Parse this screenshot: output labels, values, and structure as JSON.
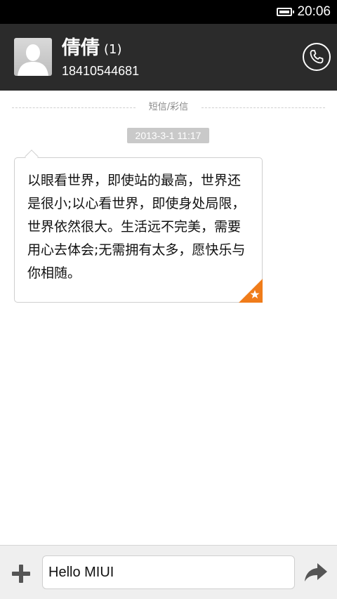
{
  "status_bar": {
    "time": "20:06",
    "battery_icon": "battery-full-icon"
  },
  "header": {
    "contact_name": "倩倩",
    "unread_count": "(1)",
    "phone_number": "18410544681",
    "avatar_icon": "person-silhouette-icon",
    "call_icon": "phone-icon"
  },
  "thread": {
    "divider_label": "短信/彩信",
    "timestamp": "2013-3-1 11:17",
    "messages": [
      {
        "text": "以眼看世界，即使站的最高，世界还是很小;以心看世界，即使身处局限，世界依然很大。生活远不完美，需要用心去体会;无需拥有太多，愿快乐与你相随。",
        "starred": true,
        "star_icon": "star-icon"
      }
    ]
  },
  "composer": {
    "input_value": "Hello MIUI",
    "add_icon": "plus-icon",
    "send_icon": "send-arrow-icon"
  },
  "colors": {
    "header_bg": "#2b2b2b",
    "accent_orange": "#f07c1a"
  }
}
